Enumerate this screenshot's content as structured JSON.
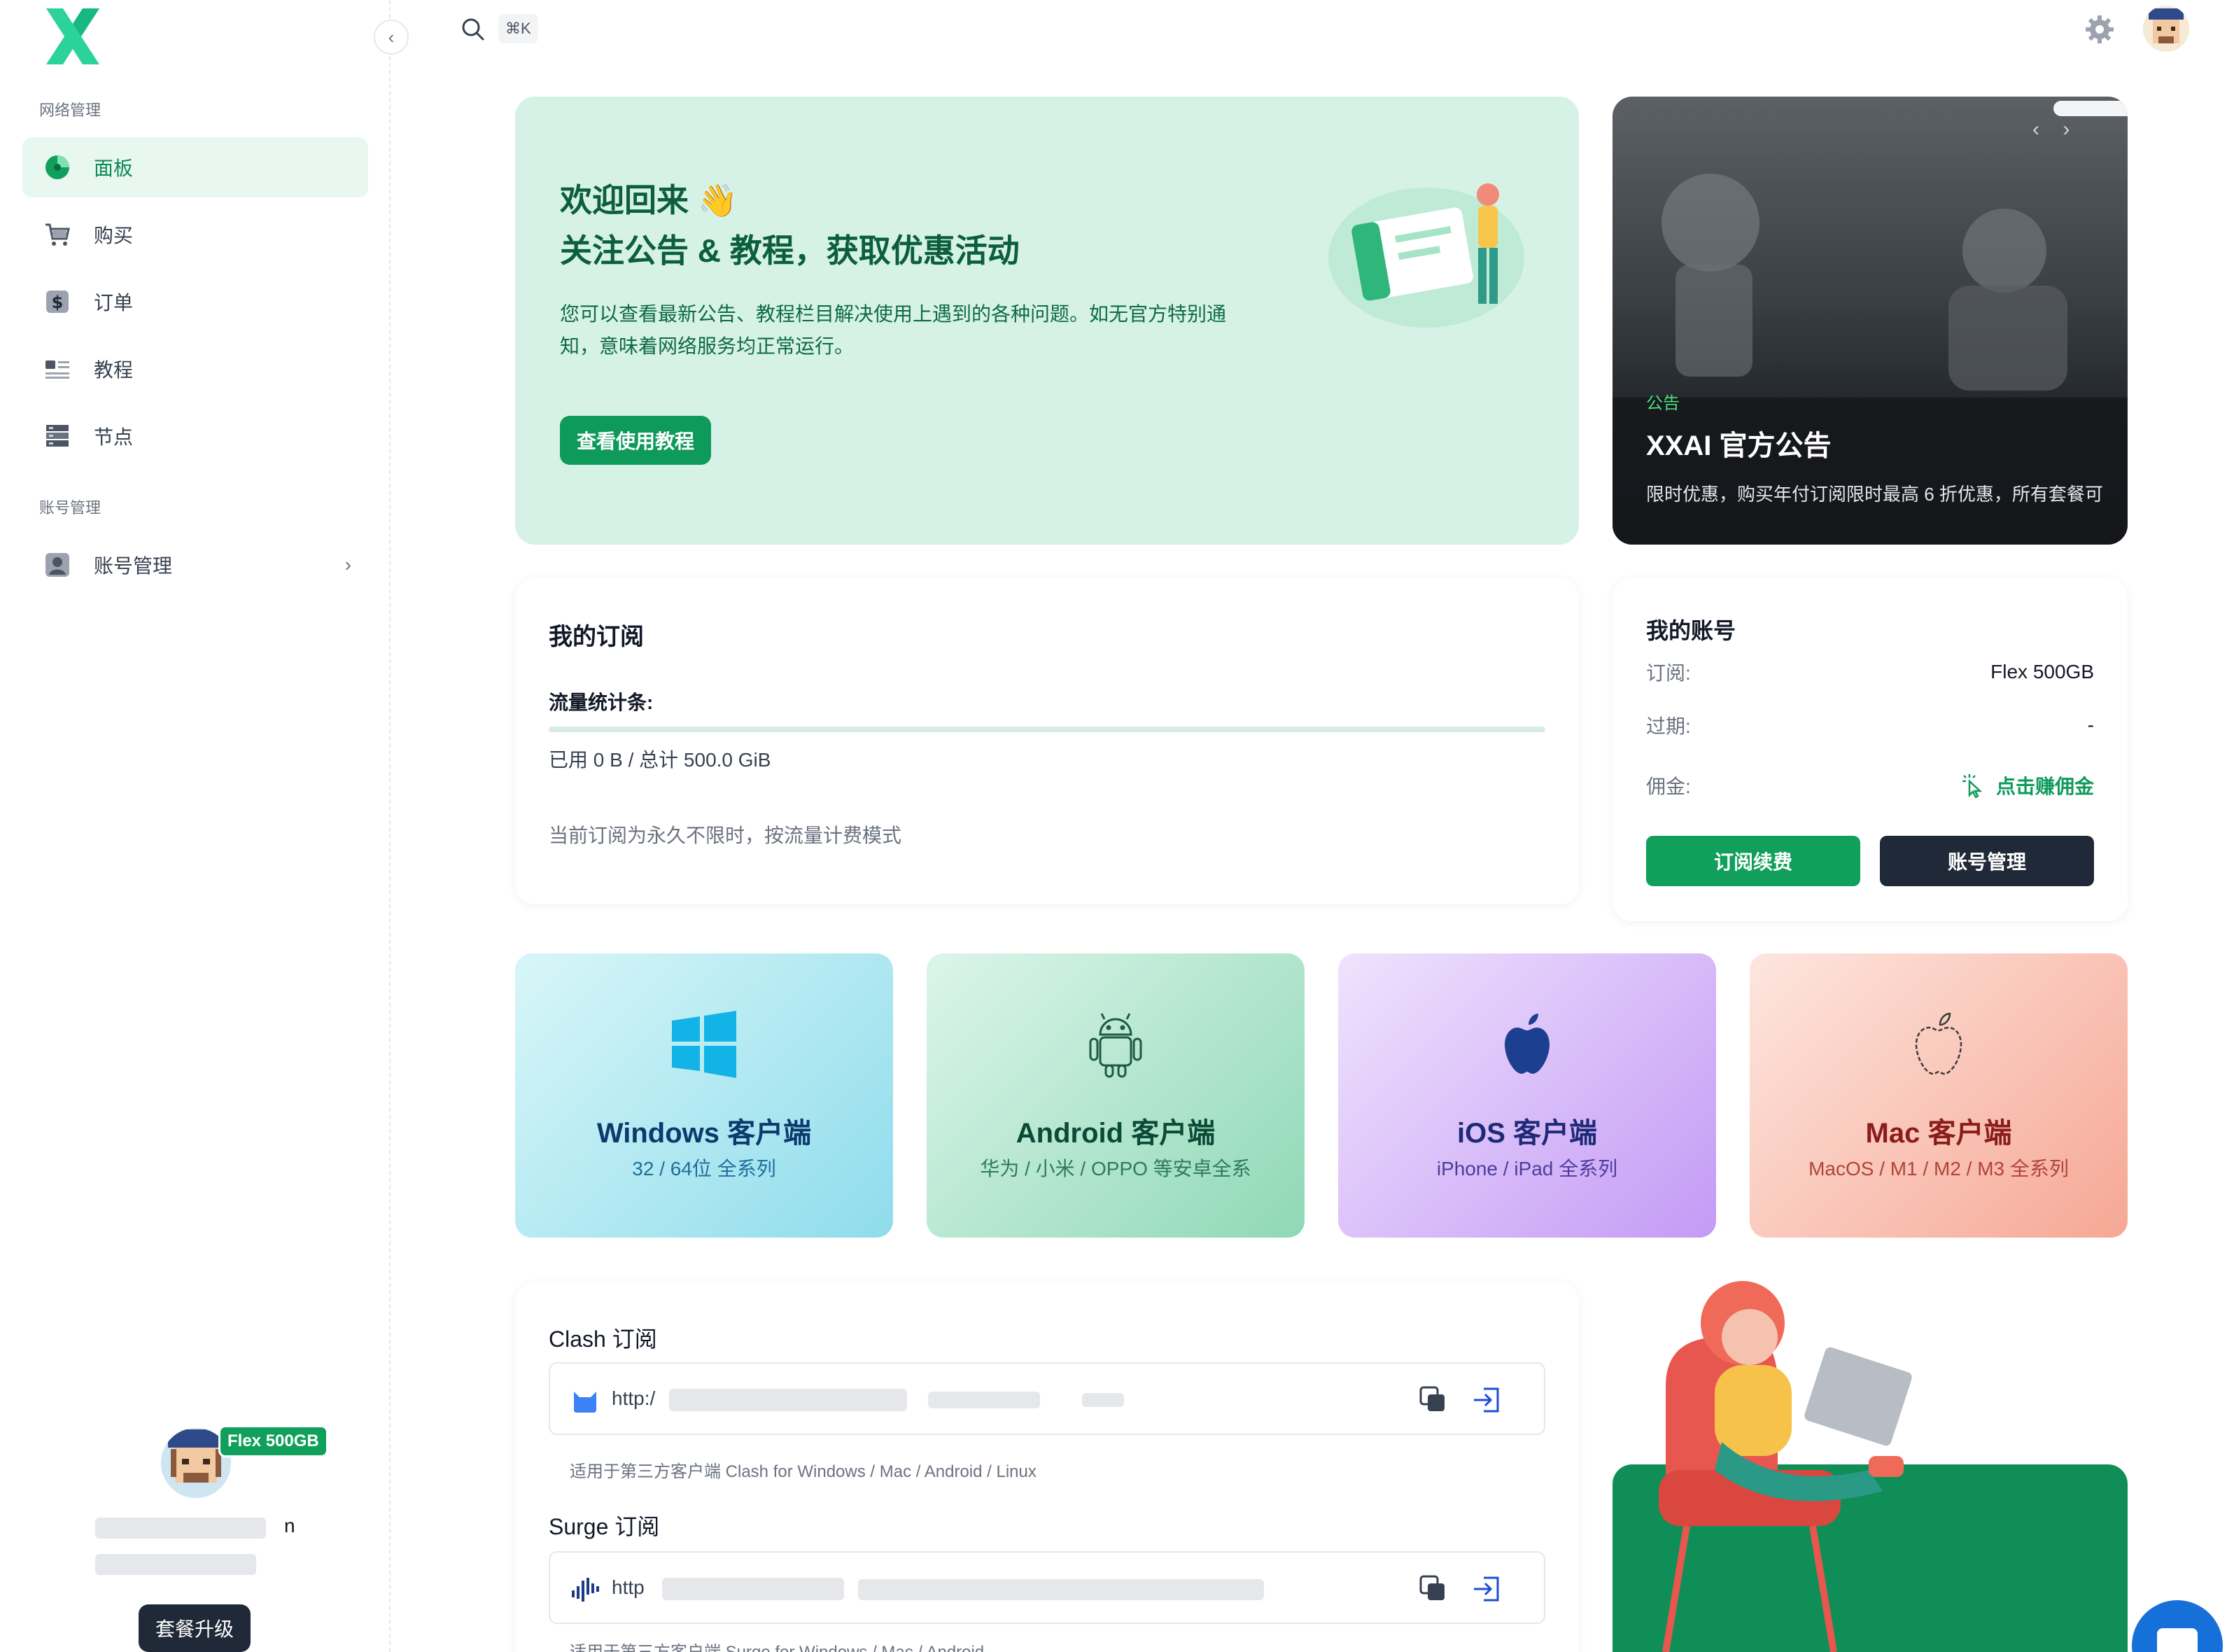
{
  "sidebar": {
    "section_network": "网络管理",
    "section_account": "账号管理",
    "items": [
      {
        "label": "面板"
      },
      {
        "label": "购买"
      },
      {
        "label": "订单"
      },
      {
        "label": "教程"
      },
      {
        "label": "节点"
      },
      {
        "label": "账号管理"
      }
    ],
    "user": {
      "plan_badge": "Flex 500GB",
      "name_tail": "n",
      "upgrade_label": "套餐升级"
    }
  },
  "topbar": {
    "shortcut": "⌘K"
  },
  "welcome": {
    "title": "欢迎回来 👋",
    "subtitle": "关注公告 & 教程，获取优惠活动",
    "description": "您可以查看最新公告、教程栏目解决使用上遇到的各种问题。如无官方特别通知，意味着网络服务均正常运行。",
    "button": "查看使用教程"
  },
  "announcement": {
    "tag": "公告",
    "title": "XXAI 官方公告",
    "description": "限时优惠，购买年付订阅限时最高 6 折优惠，所有套餐可"
  },
  "subscription": {
    "title": "我的订阅",
    "traffic_label": "流量统计条:",
    "usage_fraction": 0.0,
    "usage_text": "已用 0 B / 总计 500.0 GiB",
    "note": "当前订阅为永久不限时，按流量计费模式"
  },
  "account": {
    "title": "我的账号",
    "subscription_label": "订阅:",
    "subscription_value": "Flex 500GB",
    "expiry_label": "过期:",
    "expiry_value": "-",
    "commission_label": "佣金:",
    "commission_action": "点击赚佣金",
    "renew_button": "订阅续费",
    "manage_button": "账号管理"
  },
  "clients": [
    {
      "title": "Windows 客户端",
      "subtitle": "32 / 64位 全系列",
      "icon": "windows-icon",
      "color": "#0b3a6e"
    },
    {
      "title": "Android 客户端",
      "subtitle": "华为 / 小米 / OPPO 等安卓全系",
      "icon": "android-icon",
      "color": "#0b4a36"
    },
    {
      "title": "iOS 客户端",
      "subtitle": "iPhone / iPad 全系列",
      "icon": "apple-icon",
      "color": "#1e2a78"
    },
    {
      "title": "Mac 客户端",
      "subtitle": "MacOS / M1 / M2 / M3 全系列",
      "icon": "apple-outline-icon",
      "color": "#8a1c1c"
    }
  ],
  "links": {
    "clash": {
      "title": "Clash 订阅",
      "url_visible": "http:/",
      "hint": "适用于第三方客户端 Clash for Windows / Mac / Android / Linux"
    },
    "surge": {
      "title": "Surge 订阅",
      "url_visible": "http",
      "hint": "适用于第三方客户端 Surge for Windows / Mac / Android"
    }
  },
  "colors": {
    "accent": "#10a05b",
    "dark": "#1f2937",
    "welcome_bg": "#d6f2e6"
  }
}
